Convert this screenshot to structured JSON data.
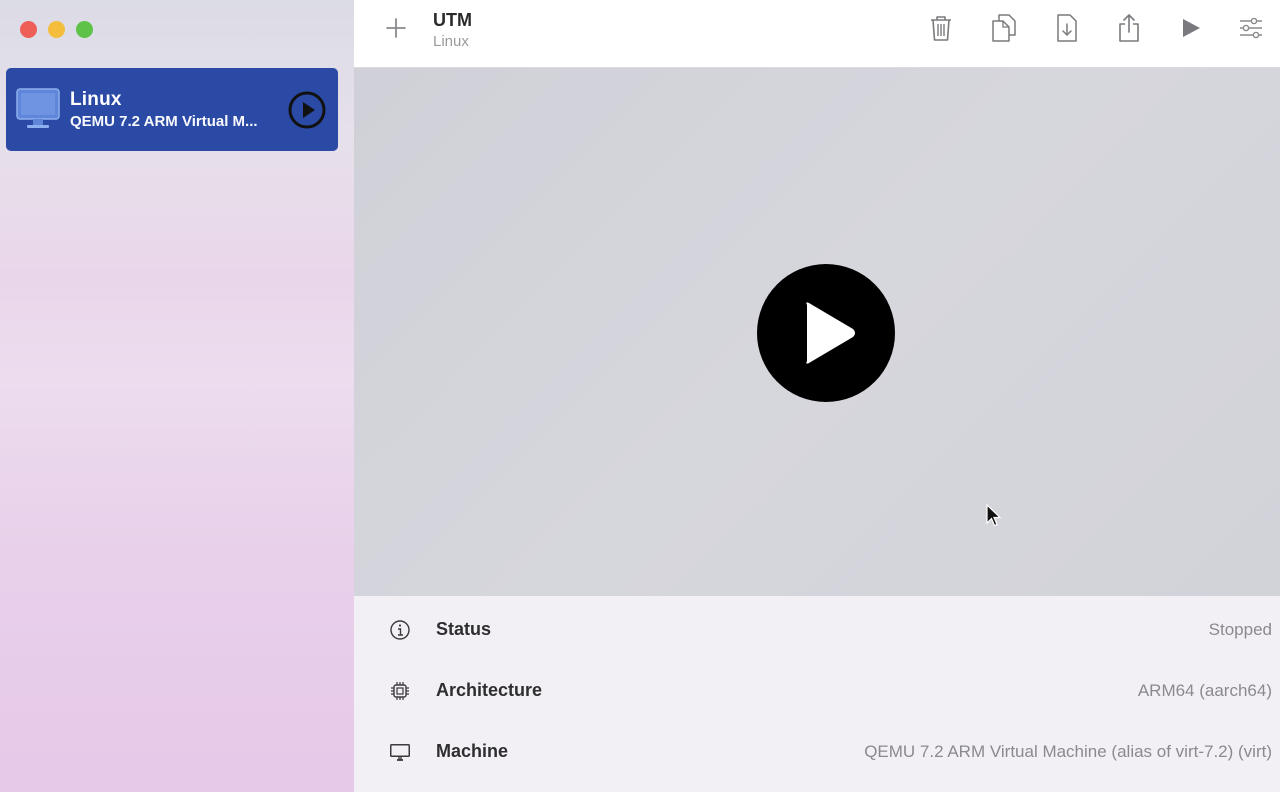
{
  "colors": {
    "accent": "#2b4aa6",
    "close": "#ee5f57",
    "minimize": "#f4bd3b",
    "maximize": "#5ec248"
  },
  "sidebar": {
    "items": [
      {
        "name": "Linux",
        "description": "QEMU 7.2 ARM Virtual M...",
        "icon": "monitor-icon",
        "action_icon": "play-circle-icon"
      }
    ]
  },
  "toolbar": {
    "add_icon": "plus-icon",
    "title": "UTM",
    "subtitle": "Linux",
    "buttons": [
      {
        "icon": "trash-icon"
      },
      {
        "icon": "clone-icon"
      },
      {
        "icon": "move-icon"
      },
      {
        "icon": "share-icon"
      },
      {
        "icon": "play-icon"
      },
      {
        "icon": "settings-icon"
      }
    ]
  },
  "preview": {
    "action_icon": "play-circle-icon"
  },
  "info": {
    "rows": [
      {
        "label": "Status",
        "value": "Stopped",
        "icon": "info-circle-icon"
      },
      {
        "label": "Architecture",
        "value": "ARM64 (aarch64)",
        "icon": "cpu-icon"
      },
      {
        "label": "Machine",
        "value": "QEMU 7.2 ARM Virtual Machine (alias of virt-7.2) (virt)",
        "icon": "display-icon"
      }
    ]
  }
}
